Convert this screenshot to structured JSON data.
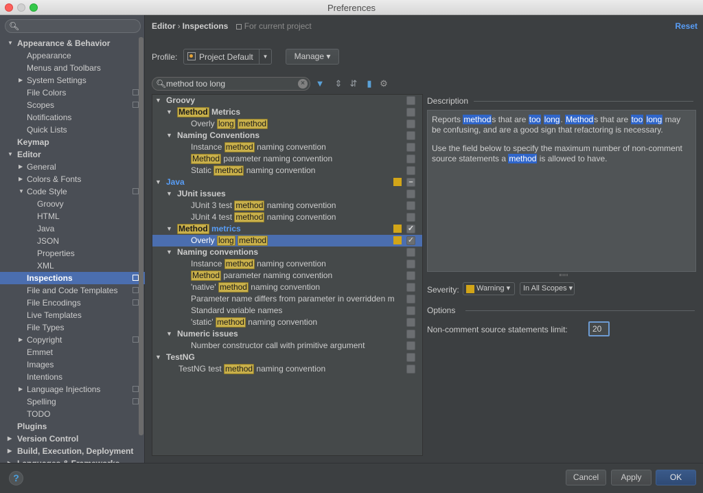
{
  "window": {
    "title": "Preferences"
  },
  "sidebar": {
    "search_placeholder": "",
    "items": [
      {
        "label": "Appearance & Behavior",
        "level": 0,
        "bold": true,
        "arrow": "down",
        "proj": false
      },
      {
        "label": "Appearance",
        "level": 1,
        "bold": false,
        "arrow": "",
        "proj": false
      },
      {
        "label": "Menus and Toolbars",
        "level": 1,
        "bold": false,
        "arrow": "",
        "proj": false
      },
      {
        "label": "System Settings",
        "level": 1,
        "bold": false,
        "arrow": "right",
        "proj": false
      },
      {
        "label": "File Colors",
        "level": 1,
        "bold": false,
        "arrow": "",
        "proj": true
      },
      {
        "label": "Scopes",
        "level": 1,
        "bold": false,
        "arrow": "",
        "proj": true
      },
      {
        "label": "Notifications",
        "level": 1,
        "bold": false,
        "arrow": "",
        "proj": false
      },
      {
        "label": "Quick Lists",
        "level": 1,
        "bold": false,
        "arrow": "",
        "proj": false
      },
      {
        "label": "Keymap",
        "level": 0,
        "bold": true,
        "arrow": "",
        "proj": false
      },
      {
        "label": "Editor",
        "level": 0,
        "bold": true,
        "arrow": "down",
        "proj": false
      },
      {
        "label": "General",
        "level": 1,
        "bold": false,
        "arrow": "right",
        "proj": false
      },
      {
        "label": "Colors & Fonts",
        "level": 1,
        "bold": false,
        "arrow": "right",
        "proj": false
      },
      {
        "label": "Code Style",
        "level": 1,
        "bold": false,
        "arrow": "down",
        "proj": true
      },
      {
        "label": "Groovy",
        "level": 2,
        "bold": false,
        "arrow": "",
        "proj": false
      },
      {
        "label": "HTML",
        "level": 2,
        "bold": false,
        "arrow": "",
        "proj": false
      },
      {
        "label": "Java",
        "level": 2,
        "bold": false,
        "arrow": "",
        "proj": false
      },
      {
        "label": "JSON",
        "level": 2,
        "bold": false,
        "arrow": "",
        "proj": false
      },
      {
        "label": "Properties",
        "level": 2,
        "bold": false,
        "arrow": "",
        "proj": false
      },
      {
        "label": "XML",
        "level": 2,
        "bold": false,
        "arrow": "",
        "proj": false
      },
      {
        "label": "Inspections",
        "level": 1,
        "bold": true,
        "arrow": "",
        "proj": true,
        "selected": true
      },
      {
        "label": "File and Code Templates",
        "level": 1,
        "bold": false,
        "arrow": "",
        "proj": true
      },
      {
        "label": "File Encodings",
        "level": 1,
        "bold": false,
        "arrow": "",
        "proj": true
      },
      {
        "label": "Live Templates",
        "level": 1,
        "bold": false,
        "arrow": "",
        "proj": false
      },
      {
        "label": "File Types",
        "level": 1,
        "bold": false,
        "arrow": "",
        "proj": false
      },
      {
        "label": "Copyright",
        "level": 1,
        "bold": false,
        "arrow": "right",
        "proj": true
      },
      {
        "label": "Emmet",
        "level": 1,
        "bold": false,
        "arrow": "",
        "proj": false
      },
      {
        "label": "Images",
        "level": 1,
        "bold": false,
        "arrow": "",
        "proj": false
      },
      {
        "label": "Intentions",
        "level": 1,
        "bold": false,
        "arrow": "",
        "proj": false
      },
      {
        "label": "Language Injections",
        "level": 1,
        "bold": false,
        "arrow": "right",
        "proj": true
      },
      {
        "label": "Spelling",
        "level": 1,
        "bold": false,
        "arrow": "",
        "proj": true
      },
      {
        "label": "TODO",
        "level": 1,
        "bold": false,
        "arrow": "",
        "proj": false
      },
      {
        "label": "Plugins",
        "level": 0,
        "bold": true,
        "arrow": "",
        "proj": false
      },
      {
        "label": "Version Control",
        "level": 0,
        "bold": true,
        "arrow": "right",
        "proj": false
      },
      {
        "label": "Build, Execution, Deployment",
        "level": 0,
        "bold": true,
        "arrow": "right",
        "proj": false
      },
      {
        "label": "Languages & Frameworks",
        "level": 0,
        "bold": true,
        "arrow": "right",
        "proj": false
      }
    ]
  },
  "header": {
    "breadcrumb_parent": "Editor",
    "breadcrumb_sep": "›",
    "breadcrumb_current": "Inspections",
    "scope_note": "For current project",
    "reset_label": "Reset"
  },
  "profile": {
    "label": "Profile:",
    "value": "Project Default",
    "manage_label": "Manage ▾"
  },
  "filter": {
    "value": "method too long",
    "highlight_terms": [
      "method",
      "Method",
      "long"
    ]
  },
  "toolbar": {
    "icons": [
      "filter-icon",
      "expand-all-icon",
      "collapse-all-icon",
      "eraser-icon",
      "gear-icon"
    ]
  },
  "tree": {
    "rows": [
      {
        "text": "Groovy",
        "level": 0,
        "group": true,
        "arrow": true,
        "checked": "none",
        "severity": false
      },
      {
        "text": "Method Metrics",
        "level": 1,
        "group": true,
        "arrow": true,
        "checked": "none",
        "severity": false
      },
      {
        "text": "Overly long method",
        "level": 2,
        "group": false,
        "arrow": false,
        "checked": "none",
        "severity": false
      },
      {
        "text": "Naming Conventions",
        "level": 1,
        "group": true,
        "arrow": true,
        "checked": "none",
        "severity": false
      },
      {
        "text": "Instance method naming convention",
        "level": 2,
        "group": false,
        "arrow": false,
        "checked": "none",
        "severity": false
      },
      {
        "text": "Method parameter naming convention",
        "level": 2,
        "group": false,
        "arrow": false,
        "checked": "none",
        "severity": false
      },
      {
        "text": "Static method naming convention",
        "level": 2,
        "group": false,
        "arrow": false,
        "checked": "none",
        "severity": false
      },
      {
        "text": "Java",
        "level": 0,
        "group": true,
        "arrow": true,
        "checked": "partial",
        "severity": true,
        "blue": true
      },
      {
        "text": "JUnit issues",
        "level": 1,
        "group": true,
        "arrow": true,
        "checked": "none",
        "severity": false
      },
      {
        "text": "JUnit 3 test method naming convention",
        "level": 2,
        "group": false,
        "arrow": false,
        "checked": "none",
        "severity": false
      },
      {
        "text": "JUnit 4 test method naming convention",
        "level": 2,
        "group": false,
        "arrow": false,
        "checked": "none",
        "severity": false
      },
      {
        "text": "Method metrics",
        "level": 1,
        "group": true,
        "arrow": true,
        "checked": "checked",
        "severity": true,
        "blue": true
      },
      {
        "text": "Overly long method",
        "level": 2,
        "group": false,
        "arrow": false,
        "checked": "checked",
        "severity": true,
        "selected": true
      },
      {
        "text": "Naming conventions",
        "level": 1,
        "group": true,
        "arrow": true,
        "checked": "none",
        "severity": false
      },
      {
        "text": "Instance method naming convention",
        "level": 2,
        "group": false,
        "arrow": false,
        "checked": "none",
        "severity": false
      },
      {
        "text": "Method parameter naming convention",
        "level": 2,
        "group": false,
        "arrow": false,
        "checked": "none",
        "severity": false
      },
      {
        "text": "'native' method naming convention",
        "level": 2,
        "group": false,
        "arrow": false,
        "checked": "none",
        "severity": false
      },
      {
        "text": "Parameter name differs from parameter in overridden m",
        "level": 2,
        "group": false,
        "arrow": false,
        "checked": "none",
        "severity": false
      },
      {
        "text": "Standard variable names",
        "level": 2,
        "group": false,
        "arrow": false,
        "checked": "none",
        "severity": false
      },
      {
        "text": "'static' method naming convention",
        "level": 2,
        "group": false,
        "arrow": false,
        "checked": "none",
        "severity": false
      },
      {
        "text": "Numeric issues",
        "level": 1,
        "group": true,
        "arrow": true,
        "checked": "none",
        "severity": false
      },
      {
        "text": "Number constructor call with primitive argument",
        "level": 2,
        "group": false,
        "arrow": false,
        "checked": "none",
        "severity": false
      },
      {
        "text": "TestNG",
        "level": 0,
        "group": true,
        "arrow": true,
        "checked": "none",
        "severity": false
      },
      {
        "text": "TestNG test method naming convention",
        "level": 1,
        "group": false,
        "arrow": false,
        "checked": "none",
        "severity": false
      }
    ]
  },
  "description": {
    "title": "Description",
    "paragraphs": [
      [
        {
          "t": "Reports "
        },
        {
          "t": "method",
          "h": true
        },
        {
          "t": "s that are "
        },
        {
          "t": "too",
          "h": true
        },
        {
          "t": " "
        },
        {
          "t": "long",
          "h": true
        },
        {
          "t": ". "
        },
        {
          "t": "Method",
          "h": true
        },
        {
          "t": "s that are "
        },
        {
          "t": "too",
          "h": true
        },
        {
          "t": " "
        },
        {
          "t": "long",
          "h": true
        },
        {
          "t": " may be confusing, and are a good sign that refactoring is necessary."
        }
      ],
      [
        {
          "t": "Use the field below to specify the maximum number of non-comment source statements a "
        },
        {
          "t": "method",
          "h": true
        },
        {
          "t": " is allowed to have."
        }
      ]
    ]
  },
  "severity": {
    "label": "Severity:",
    "value": "Warning",
    "color": "#d2a518",
    "scope_value": "In All Scopes"
  },
  "options": {
    "title": "Options",
    "limit_label": "Non-comment source statements limit:",
    "limit_value": "20"
  },
  "footer": {
    "help_label": "?",
    "cancel_label": "Cancel",
    "apply_label": "Apply",
    "ok_label": "OK"
  },
  "colors": {
    "selection": "#4b6eaf",
    "highlight": "#c9b04a",
    "match_highlight": "#2f65ca",
    "link": "#589df6",
    "warning": "#d2a518"
  }
}
